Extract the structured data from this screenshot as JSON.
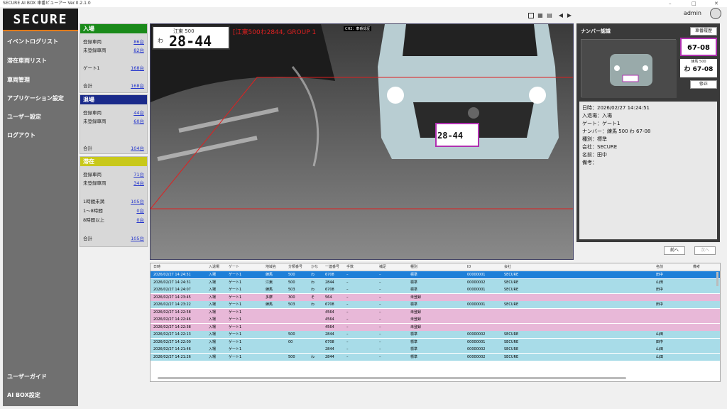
{
  "window": {
    "title": "SECURE AI BOX 車番ビューアー Ver.0.2.1.0",
    "controls": [
      "–",
      "□",
      "✕"
    ]
  },
  "header": {
    "user": "admin"
  },
  "sidebar": {
    "logo": "SECURE",
    "items": [
      "イベントログリスト",
      "滞在車両リスト",
      "車両管理",
      "アプリケーション設定",
      "ユーザー設定",
      "ログアウト"
    ],
    "bottom_items": [
      "ユーザーガイド",
      "AI BOX設定"
    ]
  },
  "stats": {
    "entry": {
      "title": "入場",
      "color": "#1a8a1a",
      "rows": [
        {
          "label": "登録車両",
          "value": "86台"
        },
        {
          "label": "未登録車両",
          "value": "82台"
        },
        {
          "label": "ゲート1",
          "value": "168台"
        },
        {
          "label": "合計",
          "value": "168台"
        }
      ]
    },
    "exit": {
      "title": "退場",
      "color": "#1a2a8a",
      "rows": [
        {
          "label": "登録車両",
          "value": "44台"
        },
        {
          "label": "未登録車両",
          "value": "60台"
        },
        {
          "label": "合計",
          "value": "104台"
        }
      ]
    },
    "stay": {
      "title": "滞在",
      "color": "#c8c81a",
      "rows": [
        {
          "label": "登録車両",
          "value": "71台"
        },
        {
          "label": "未登録車両",
          "value": "34台"
        },
        {
          "label": "1時間未満",
          "value": "105台"
        },
        {
          "label": "1～8時間",
          "value": "0台"
        },
        {
          "label": "8時間以上",
          "value": "0台"
        },
        {
          "label": "合計",
          "value": "105台"
        }
      ]
    }
  },
  "camera": {
    "overlay": "[江東500わ2844, GROUP 1",
    "channel": "CH2：車番認証",
    "plate_top": "江東 500",
    "plate_num": "28-44",
    "plate_kana": "わ"
  },
  "detail": {
    "title": "ナンバー認識",
    "history_button": "車番履歴",
    "crop_plate": "67-08",
    "plate_line1": "練馬 500",
    "plate_line2": "わ 67-08",
    "edit_button": "修正",
    "fields": [
      "日時：2026/02/27 14:24:51",
      "入退場：入場",
      "ゲート：ゲート1",
      "ナンバー：練馬 500 わ 67-08",
      "種別：標準",
      "会社：SECURE",
      "名前：田中",
      "備考："
    ],
    "prev_button": "前へ",
    "next_button": "次へ"
  },
  "table": {
    "columns": [
      "日時",
      "入退場",
      "ゲート",
      "地域名",
      "分類番号",
      "かな",
      "一連番号",
      "手数",
      "補足",
      "種別",
      "ID",
      "会社",
      "名前",
      "備考"
    ],
    "rows": [
      [
        "2026/02/27 14:24:51",
        "入場",
        "ゲート1",
        "練馬",
        "500",
        "わ",
        "6708",
        "–",
        "–",
        "標準",
        "00000001",
        "SECURE",
        "田中",
        ""
      ],
      [
        "2026/02/27 14:24:31",
        "入場",
        "ゲート1",
        "江東",
        "500",
        "わ",
        "2844",
        "–",
        "–",
        "標準",
        "00000002",
        "SECURE",
        "山田",
        ""
      ],
      [
        "2026/02/27 14:24:07",
        "入場",
        "ゲート1",
        "練馬",
        "503",
        "わ",
        "6708",
        "–",
        "–",
        "標準",
        "00000001",
        "SECURE",
        "田中",
        ""
      ],
      [
        "2026/02/27 14:23:45",
        "入場",
        "ゲート1",
        "多摩",
        "300",
        "そ",
        "564",
        "–",
        "–",
        "未登録",
        "",
        "",
        "",
        ""
      ],
      [
        "2026/02/27 14:23:22",
        "入場",
        "ゲート1",
        "練馬",
        "503",
        "わ",
        "6708",
        "–",
        "–",
        "標準",
        "00000001",
        "SECURE",
        "田中",
        ""
      ],
      [
        "2026/02/27 14:22:58",
        "入場",
        "ゲート1",
        "",
        "",
        "",
        "4564",
        "–",
        "–",
        "未登録",
        "",
        "",
        "",
        ""
      ],
      [
        "2026/02/27 14:22:46",
        "入場",
        "ゲート1",
        "",
        "",
        "",
        "4564",
        "–",
        "–",
        "未登録",
        "",
        "",
        "",
        ""
      ],
      [
        "2026/02/27 14:22:38",
        "入場",
        "ゲート1",
        "",
        "",
        "",
        "4564",
        "–",
        "–",
        "未登録",
        "",
        "",
        "",
        ""
      ],
      [
        "2026/02/27 14:22:13",
        "入場",
        "ゲート1",
        "",
        "500",
        "",
        "2844",
        "–",
        "–",
        "標準",
        "00000002",
        "SECURE",
        "山田",
        ""
      ],
      [
        "2026/02/27 14:22:00",
        "入場",
        "ゲート1",
        "",
        "00",
        "",
        "6708",
        "–",
        "–",
        "標準",
        "00000001",
        "SECURE",
        "田中",
        ""
      ],
      [
        "2026/02/27 14:21:46",
        "入場",
        "ゲート1",
        "",
        "",
        "",
        "2844",
        "–",
        "–",
        "標準",
        "00000002",
        "SECURE",
        "山田",
        ""
      ],
      [
        "2026/02/27 14:21:26",
        "入場",
        "ゲート1",
        "",
        "500",
        "わ",
        "2844",
        "–",
        "–",
        "標準",
        "00000002",
        "SECURE",
        "山田",
        ""
      ]
    ],
    "row_colors": [
      "#1e7fd8",
      "#a8dce8",
      "#a8dce8",
      "#e8b8d8",
      "#a8dce8",
      "#e8b8d8",
      "#e8b8d8",
      "#e8b8d8",
      "#a8dce8",
      "#a8dce8",
      "#a8dce8",
      "#a8dce8"
    ]
  }
}
